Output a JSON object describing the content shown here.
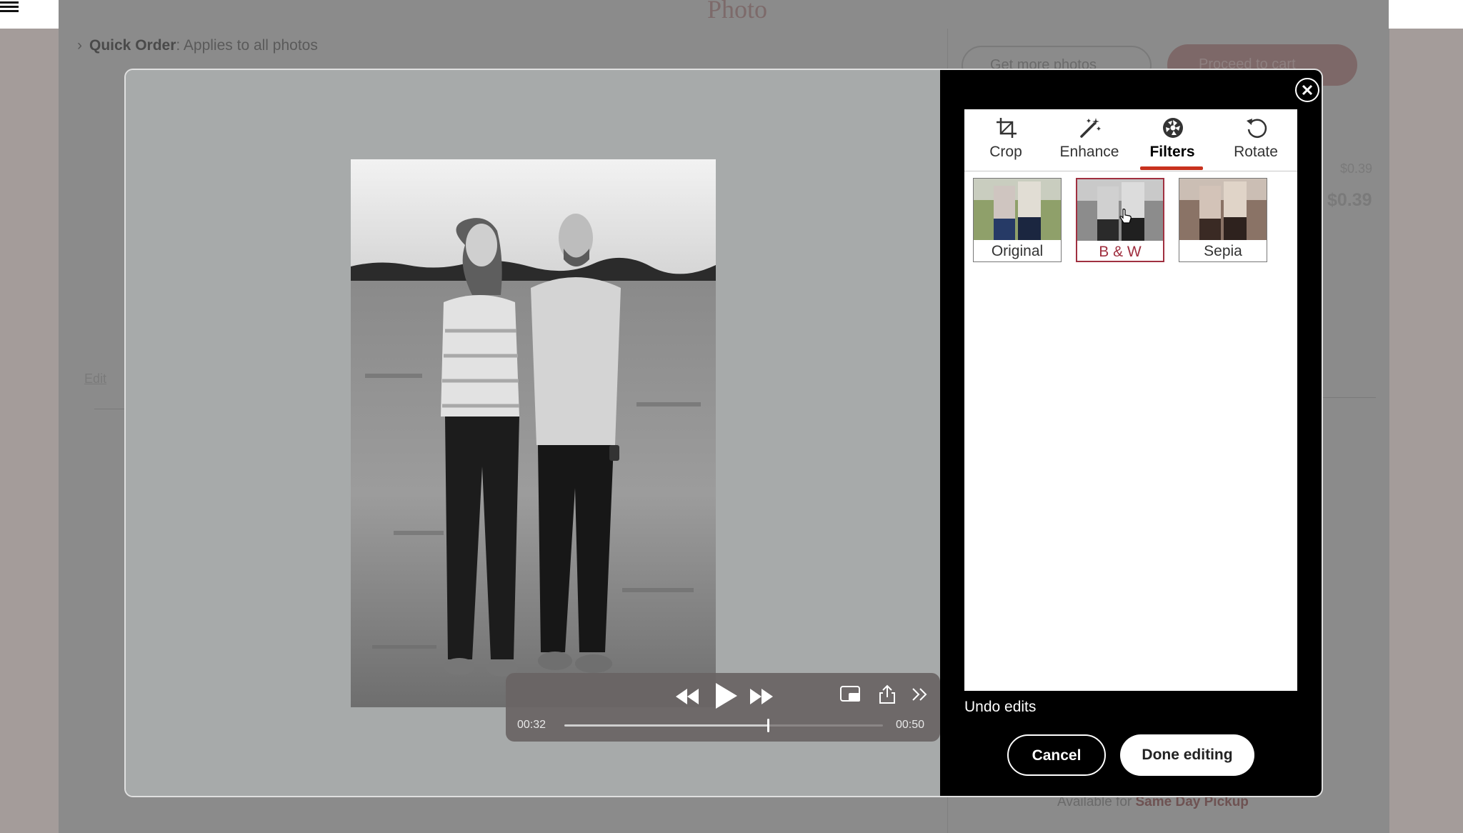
{
  "header": {
    "logo_text": "Photo",
    "quick_order_label": "Quick Order",
    "quick_order_text": ": Applies to all photos"
  },
  "background": {
    "get_more_photos": "Get more photos",
    "proceed_to_cart": "Proceed to cart",
    "price_small": "$0.39",
    "price_big": "$0.39",
    "edit_link": "Edit",
    "available_prefix": "Available for",
    "available_option": "Same Day Pickup"
  },
  "media": {
    "elapsed": "00:32",
    "total": "00:50",
    "progress": 0.64
  },
  "editor": {
    "tabs": [
      {
        "label": "Crop",
        "icon": "crop-icon"
      },
      {
        "label": "Enhance",
        "icon": "magic-wand-icon"
      },
      {
        "label": "Filters",
        "icon": "aperture-icon",
        "active": true
      },
      {
        "label": "Rotate",
        "icon": "rotate-icon"
      }
    ],
    "filters": [
      {
        "label": "Original"
      },
      {
        "label": "B & W",
        "selected": true
      },
      {
        "label": "Sepia"
      }
    ],
    "undo_edits": "Undo edits",
    "cancel": "Cancel",
    "done": "Done editing"
  },
  "colors": {
    "accent": "#c8321e",
    "selected_filter": "#a03040",
    "overlay": "#8b8b8b"
  }
}
